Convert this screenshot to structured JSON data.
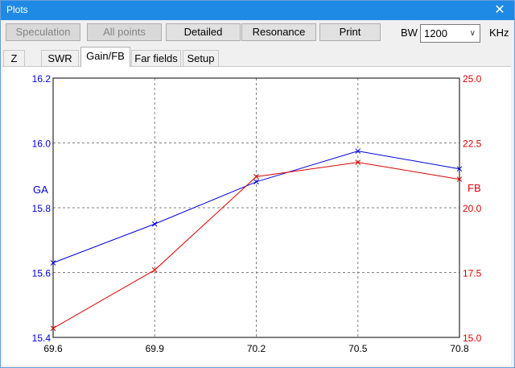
{
  "window": {
    "title": "Plots",
    "close_glyph": "✕"
  },
  "toolbar": {
    "buttons": [
      {
        "label": "Speculation",
        "enabled": false
      },
      {
        "label": "All points",
        "enabled": false
      },
      {
        "label": "Detailed",
        "enabled": true
      },
      {
        "label": "Resonance",
        "enabled": true
      },
      {
        "label": "Print",
        "enabled": true
      }
    ],
    "bw_label": "BW",
    "bw_value": "1200",
    "khz_label": "KHz"
  },
  "tabs": [
    {
      "label": "Z",
      "active": false
    },
    {
      "label": "SWR",
      "active": false
    },
    {
      "label": "Gain/FB",
      "active": true
    },
    {
      "label": "Far fields",
      "active": false
    },
    {
      "label": "Setup",
      "active": false
    }
  ],
  "colors": {
    "ga": "#0000dd",
    "fb": "#dd0000",
    "titlebar": "#1f8ae6"
  },
  "chart_data": {
    "type": "line",
    "x": [
      69.6,
      69.9,
      70.2,
      70.5,
      70.8
    ],
    "x_ticks": [
      "69.6",
      "69.9",
      "70.2",
      "70.5",
      "70.8"
    ],
    "xlim": [
      69.6,
      70.8
    ],
    "grid": true,
    "series": [
      {
        "name": "GA",
        "axis": "left",
        "values": [
          15.63,
          15.75,
          15.88,
          15.975,
          15.92
        ],
        "color": "#0000dd"
      },
      {
        "name": "FB",
        "axis": "right",
        "values": [
          15.35,
          17.6,
          21.2,
          21.75,
          21.1
        ],
        "color": "#dd0000"
      }
    ],
    "y_left": {
      "label": "GA",
      "lim": [
        15.4,
        16.2
      ],
      "ticks": [
        "15.4",
        "15.6",
        "15.8",
        "16.0",
        "16.2"
      ]
    },
    "y_right": {
      "label": "FB",
      "lim": [
        15.0,
        25.0
      ],
      "ticks": [
        "15.0",
        "17.5",
        "20.0",
        "22.5",
        "25.0"
      ]
    }
  }
}
